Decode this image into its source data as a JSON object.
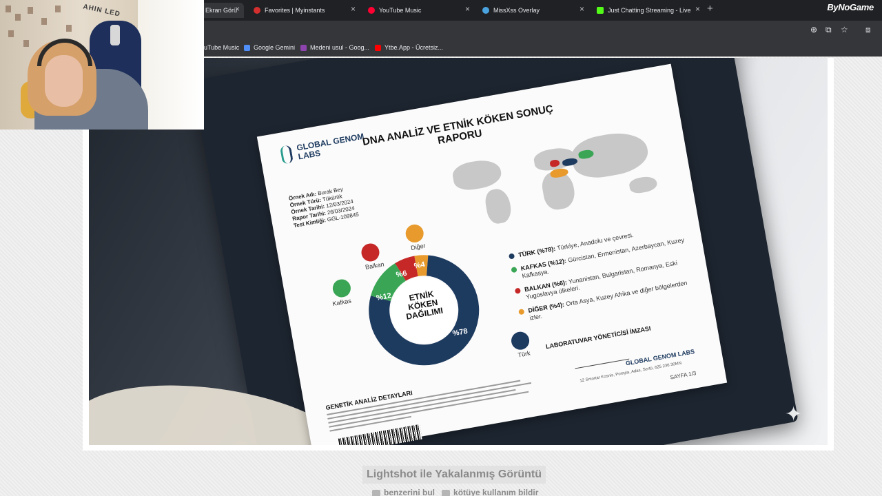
{
  "browser": {
    "tabs": [
      {
        "title": "Ekran Görü",
        "color": "#7f8c8d",
        "active": true
      },
      {
        "title": "Favorites | Myinstants",
        "color": "#d32f2f"
      },
      {
        "title": "YouTube Music",
        "color": "#ff0033"
      },
      {
        "title": "MissXss Overlay",
        "color": "#4aa3df"
      },
      {
        "title": "Just Chatting Streaming - Live",
        "color": "#53fc18"
      }
    ],
    "tab_close": "×",
    "new_tab": "+",
    "brand": "ByNoGame",
    "toolbar_icons": {
      "zoom": "⊕",
      "install": "⧉",
      "star": "☆",
      "extensions": "⧈"
    },
    "bookmarks": [
      {
        "label": "uTube Music",
        "color": "#ff0033"
      },
      {
        "label": "Google Gemini",
        "color": "#4f8ff7"
      },
      {
        "label": "Medeni usul - Goog...",
        "color": "#8e44ad"
      },
      {
        "label": "Ytbe.App - Ücretsiz...",
        "color": "#ff0000"
      }
    ]
  },
  "webcam": {
    "sign": "AHIN LED"
  },
  "document": {
    "logo": "GLOBAL GENOM LABS",
    "title": "DNA ANALİZ VE ETNİK KÖKEN SONUÇ RAPORU",
    "meta": [
      {
        "key": "Örnek Adı:",
        "value": "Burak Bey"
      },
      {
        "key": "Örnek Türü:",
        "value": "Tükürük"
      },
      {
        "key": "Örnek Tarihi:",
        "value": "12/03/2024"
      },
      {
        "key": "Rapor Tarihi:",
        "value": "26/03/2024"
      },
      {
        "key": "Test Kimliği:",
        "value": "GGL-109845"
      }
    ],
    "donut_center": "ETNİK KÖKEN DAĞILIMI",
    "segments": [
      {
        "name": "Türk",
        "pct_label": "%78",
        "value": 78,
        "color": "#1d3a5f"
      },
      {
        "name": "Kafkas",
        "pct_label": "%12",
        "value": 12,
        "color": "#3aa655"
      },
      {
        "name": "Balkan",
        "pct_label": "%6",
        "value": 6,
        "color": "#c62828"
      },
      {
        "name": "Diğer",
        "pct_label": "%4",
        "value": 4,
        "color": "#e89a2c"
      }
    ],
    "legend": [
      {
        "label": "TÜRK (%78):",
        "text": "Türkiye, Anadolu ve çevresi.",
        "color": "#1d3a5f"
      },
      {
        "label": "KAFKAS (%12):",
        "text": "Gürcistan, Ermenistan, Azerbaycan, Kuzey Kafkasya.",
        "color": "#3aa655"
      },
      {
        "label": "BALKAN (%6):",
        "text": "Yunanistan, Bulgaristan, Romanya, Eski Yugoslavya ülkeleri.",
        "color": "#c62828"
      },
      {
        "label": "DİĞER (%4):",
        "text": "Orta Asya, Kuzey Afrika ve diğer bölgelerden izler.",
        "color": "#e89a2c"
      }
    ],
    "signature_title": "LABORATUVAR YÖNETİCİSİ İMZASI",
    "signature_lab": "GLOBAL GENOM LABS",
    "address": "12 Smortar Kosnis, Pomyla, Adas, Sertü, 625 236 30MN",
    "page": "SAYFA 1/3",
    "genetic_title": "GENETİK ANALİZ DETAYLARI"
  },
  "caption": "Lightshot ile Yakalanmış Görüntü",
  "footer": {
    "similar": "benzerini bul",
    "report": "kötüye kullanım bildir"
  }
}
